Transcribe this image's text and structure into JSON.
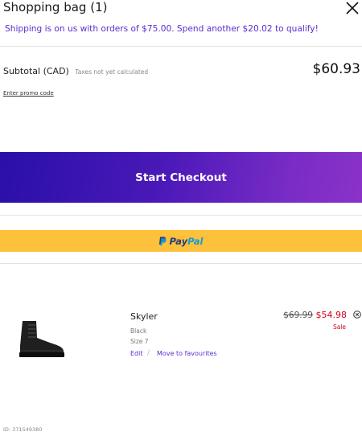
{
  "header": {
    "title": "Shopping bag (1)"
  },
  "shipping_message": "Shipping is on us with orders of $75.00. Spend another $20.02 to qualify!",
  "summary": {
    "subtotal_label": "Subtotal (CAD)",
    "tax_note": "Taxes not yet calculated",
    "subtotal_amount": "$60.93",
    "promo_link": "Enter promo code"
  },
  "checkout": {
    "label": "Start Checkout"
  },
  "paypal": {
    "part1": "Pay",
    "part2": "Pal"
  },
  "item": {
    "name": "Skyler",
    "color": "Black",
    "size": "Size 7",
    "edit_label": "Edit",
    "separator": "/",
    "favourites_label": "Move to favourites",
    "original_price": "$69.99",
    "sale_price": "$54.98",
    "sale_badge": "Sale",
    "id": "ID: 371549380"
  },
  "colors": {
    "accent_purple": "#5b2ccf",
    "checkout_gradient_start": "#2a0fa8",
    "checkout_gradient_end": "#8a32c8",
    "paypal_yellow": "#fdc13c",
    "sale_red": "#d0021b"
  },
  "icons": {
    "close": "close-icon",
    "remove": "remove-item-icon",
    "paypal": "paypal-logo-icon"
  }
}
